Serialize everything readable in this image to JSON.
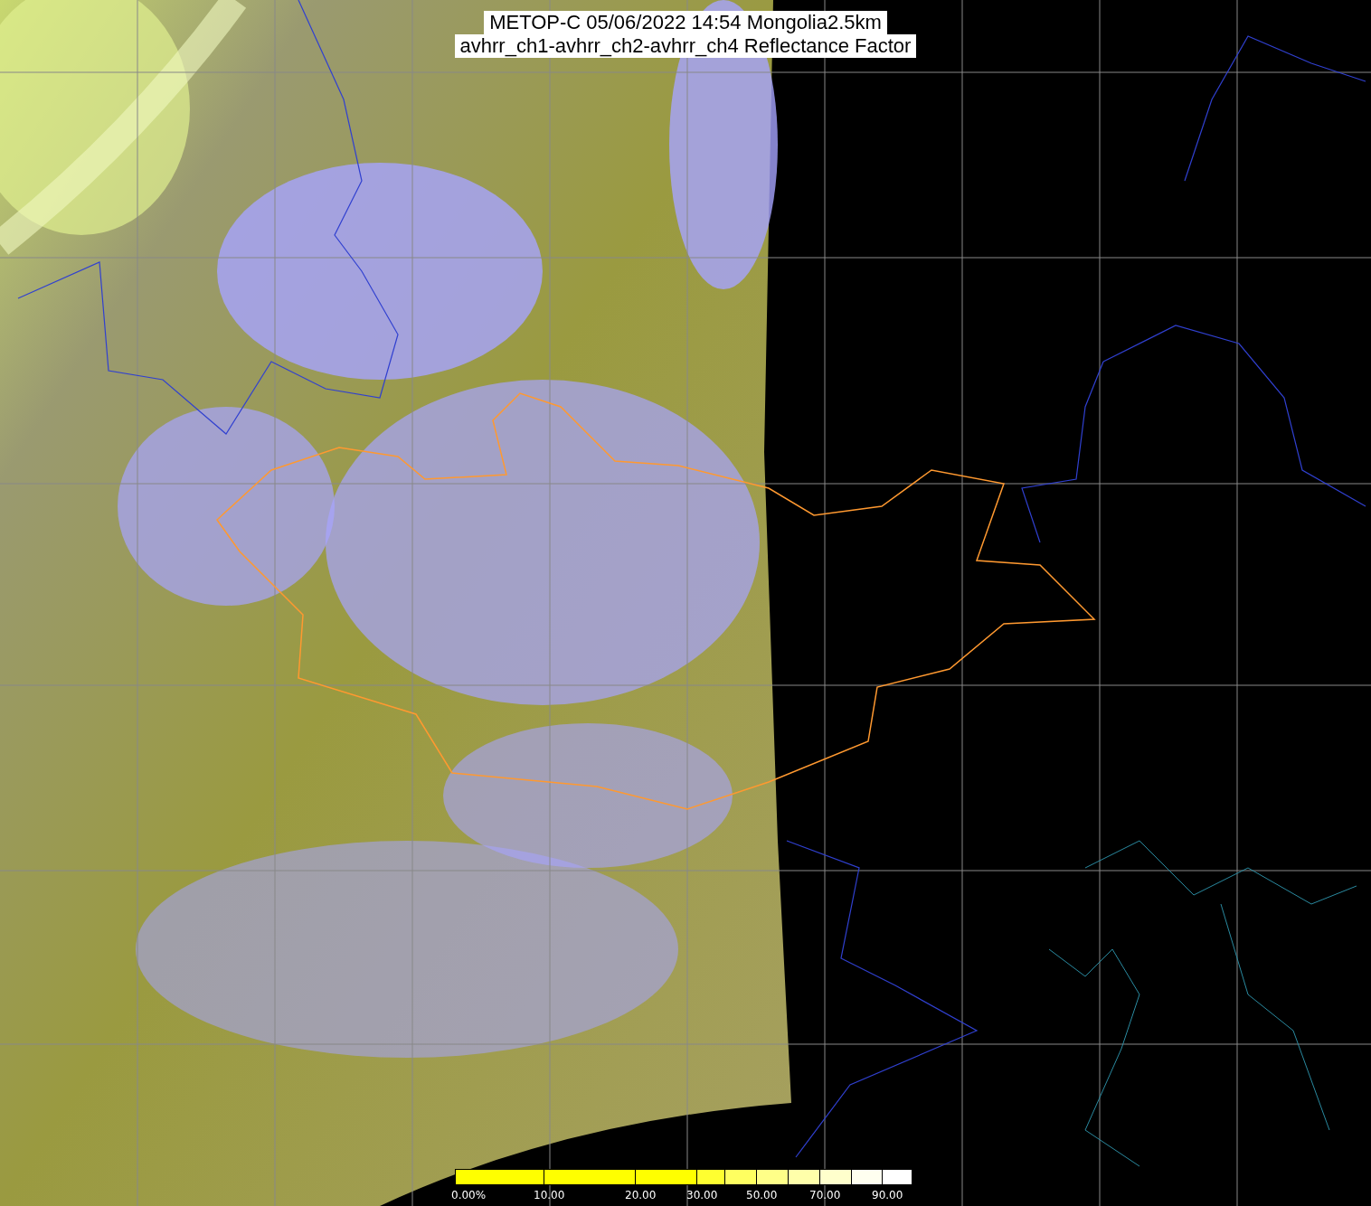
{
  "title": {
    "lines": [
      "METOP-C 05/06/2022 14:54 Mongolia2.5km",
      "avhrr_ch1-avhrr_ch2-avhrr_ch4 Reflectance Factor"
    ]
  },
  "colorbar": {
    "segments": [
      {
        "color": "#ffff00"
      },
      {
        "color": "#ffff00"
      },
      {
        "color": "#ffff00"
      },
      {
        "color": "#ffff30"
      },
      {
        "color": "#ffff60"
      },
      {
        "color": "#ffff88"
      },
      {
        "color": "#ffffaa"
      },
      {
        "color": "#ffffcc"
      },
      {
        "color": "#fffff0"
      },
      {
        "color": "#ffffff"
      }
    ],
    "labels": [
      "0.00%",
      "10.00",
      "20.00",
      "30.00",
      "50.00",
      "70.00",
      "90.00"
    ]
  }
}
